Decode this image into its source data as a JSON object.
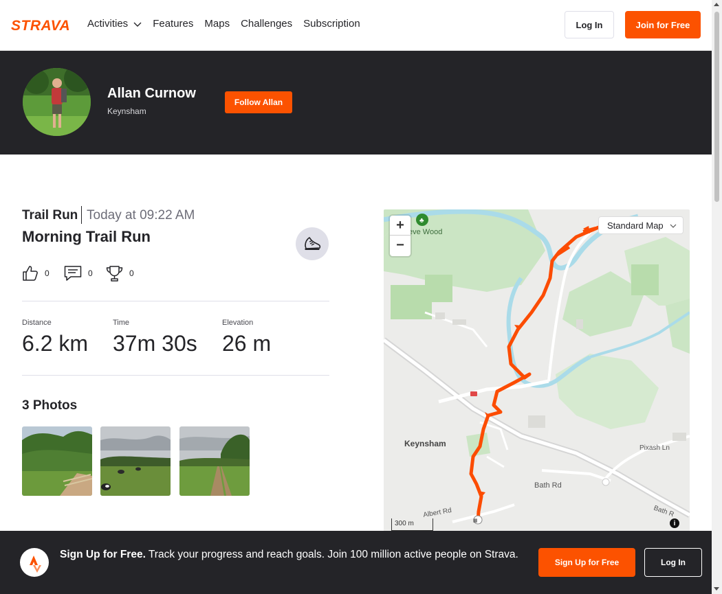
{
  "brand": {
    "logo_text": "STRAVA",
    "accent": "#fc5200",
    "dark": "#242428"
  },
  "nav": {
    "items": [
      {
        "label": "Activities",
        "has_dropdown": true
      },
      {
        "label": "Features"
      },
      {
        "label": "Maps"
      },
      {
        "label": "Challenges"
      },
      {
        "label": "Subscription"
      }
    ],
    "login_label": "Log In",
    "join_label": "Join for Free"
  },
  "athlete": {
    "name": "Allan Curnow",
    "location": "Keynsham",
    "follow_label": "Follow Allan"
  },
  "activity": {
    "type": "Trail Run",
    "date": "Today at 09:22 AM",
    "title": "Morning Trail Run",
    "sport_icon": "trail-shoe-icon",
    "kudos_count": "0",
    "comments_count": "0",
    "achievements_count": "0",
    "stats": [
      {
        "label": "Distance",
        "value": "6.2 km"
      },
      {
        "label": "Time",
        "value": "37m 30s"
      },
      {
        "label": "Elevation",
        "value": "26 m"
      }
    ]
  },
  "photos": {
    "title": "3 Photos",
    "items": [
      "photo-1",
      "photo-2",
      "photo-3"
    ]
  },
  "map": {
    "style_select": "Standard Map",
    "zoom_in": "+",
    "zoom_out": "−",
    "scale": "300 m",
    "labels": {
      "wood": "eve Wood",
      "town": "Keynsham",
      "road1": "Bath Rd",
      "road2": "Albert Rd",
      "road3": "Pixash Ln",
      "road4": "Bath R"
    },
    "route_color": "#fc4c02"
  },
  "banner": {
    "headline": "Sign Up for Free.",
    "text": "Track your progress and reach goals. Join 100 million active people on Strava.",
    "signup_label": "Sign Up for Free",
    "login_label": "Log In"
  }
}
